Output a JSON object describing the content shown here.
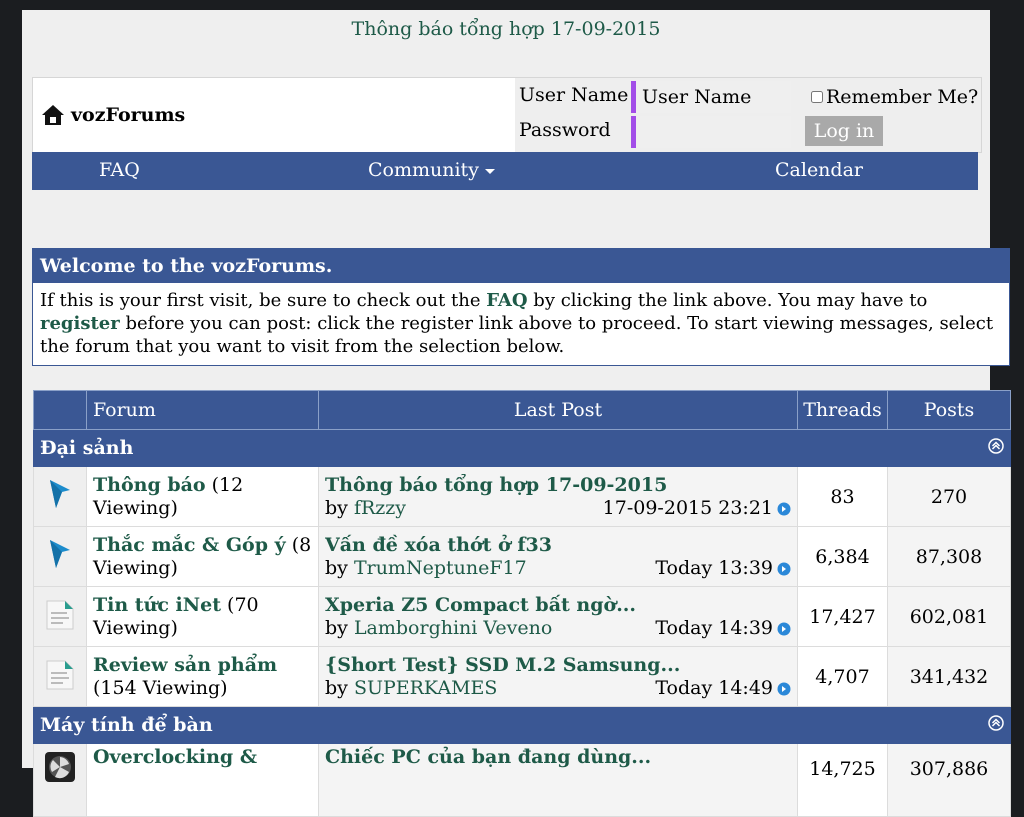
{
  "notice": "Thông báo tổng hợp 17-09-2015",
  "logo": {
    "text": "vozForums",
    "icon": "house-icon"
  },
  "login": {
    "username_label": "User Name",
    "username_placeholder": "User Name",
    "password_label": "Password",
    "remember_label": "Remember Me?",
    "login_button": "Log in"
  },
  "nav": {
    "faq": "FAQ",
    "community": "Community",
    "calendar": "Calendar"
  },
  "welcome": {
    "title": "Welcome to the vozForums.",
    "p1": "If this is your first visit, be sure to check out the ",
    "faq": "FAQ",
    "p2": " by clicking the link above. You may have to ",
    "register": "register",
    "p3": " before you can post: click the register link above to proceed. To start viewing messages, select the forum that you want to visit from the selection below."
  },
  "table": {
    "headers": {
      "forum": "Forum",
      "last_post": "Last Post",
      "threads": "Threads",
      "posts": "Posts"
    },
    "categories": [
      {
        "name": "Đại sảnh"
      },
      {
        "name": "Máy tính để bàn"
      }
    ],
    "forums": [
      {
        "title": "Thông báo",
        "viewing": " (12 Viewing)",
        "last_title": "Thông báo tổng hợp 17-09-2015",
        "by": "by ",
        "user": "fRzzy",
        "time": "17-09-2015 23:21",
        "threads": "83",
        "posts": "270",
        "icon": "pin-icon"
      },
      {
        "title": "Thắc mắc & Góp ý",
        "viewing": " (8 Viewing)",
        "last_title": "Vấn đề xóa thớt ở f33",
        "by": "by ",
        "user": "TrumNeptuneF17",
        "time": "Today 13:39",
        "threads": "6,384",
        "posts": "87,308",
        "icon": "pin-icon"
      },
      {
        "title": "Tin tức iNet",
        "viewing": " (70 Viewing)",
        "last_title": "Xperia Z5 Compact bất ngờ...",
        "by": "by ",
        "user": "Lamborghini Veveno",
        "time": "Today 14:39",
        "threads": "17,427",
        "posts": "602,081",
        "icon": "document-icon"
      },
      {
        "title": "Review sản phẩm",
        "viewing": " (154 Viewing)",
        "last_title": "{Short Test} SSD M.2 Samsung...",
        "by": "by ",
        "user": "SUPERKAMES",
        "time": "Today 14:49",
        "threads": "4,707",
        "posts": "341,432",
        "icon": "document-icon"
      },
      {
        "title": "Overclocking &",
        "viewing": "",
        "last_title": "Chiếc PC của bạn đang dùng...",
        "by": "",
        "user": "",
        "time": "",
        "threads": "14,725",
        "posts": "307,886",
        "icon": "fan-icon"
      }
    ]
  },
  "colors": {
    "accent": "#3a5794",
    "link": "#1e5a48",
    "input_border": "#a24ee8"
  }
}
